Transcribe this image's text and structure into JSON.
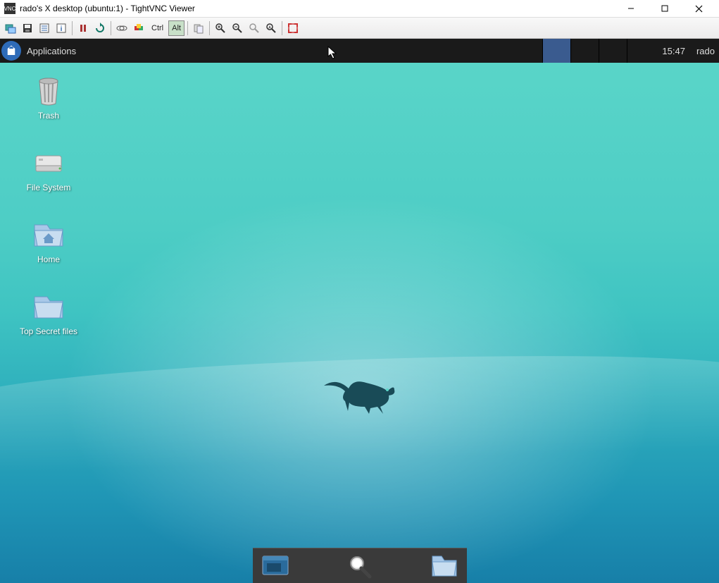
{
  "vnc": {
    "title": "rado's X desktop (ubuntu:1) - TightVNC Viewer",
    "ctrl_label": "Ctrl",
    "alt_label": "Alt"
  },
  "xfce": {
    "applications_label": "Applications",
    "clock": "15:47",
    "user": "rado"
  },
  "desktop_icons": [
    {
      "id": "trash",
      "label": "Trash"
    },
    {
      "id": "filesystem",
      "label": "File System"
    },
    {
      "id": "home",
      "label": "Home"
    },
    {
      "id": "top-secret",
      "label": "Top Secret files"
    }
  ],
  "colors": {
    "panel_bg": "#1a1a1a",
    "xfce_blue": "#2e6bb8",
    "gradient_top": "#5bd6c9",
    "gradient_bottom": "#177fa8",
    "workspace_active": "#3a5b8f"
  }
}
